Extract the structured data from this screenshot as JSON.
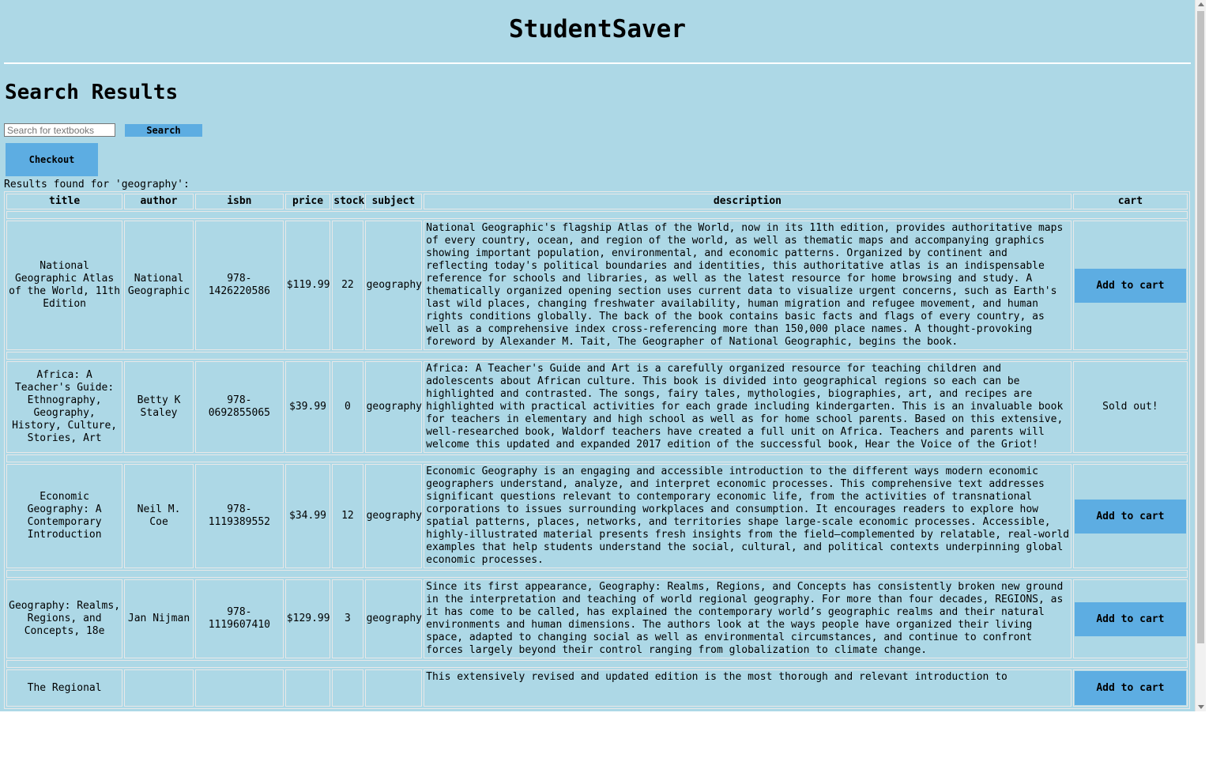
{
  "site": {
    "title": "StudentSaver"
  },
  "page": {
    "heading": "Search Results"
  },
  "search": {
    "placeholder": "Search for textbooks",
    "button_label": "Search"
  },
  "checkout": {
    "label": "Checkout"
  },
  "results": {
    "summary": "Results found for 'geography':"
  },
  "table": {
    "headers": [
      "title",
      "author",
      "isbn",
      "price",
      "stock",
      "subject",
      "description",
      "cart"
    ],
    "rows": [
      {
        "title": "National Geographic Atlas of the World, 11th Edition",
        "author": "National Geographic",
        "isbn": "978-1426220586",
        "price": "$119.99",
        "stock": "22",
        "subject": "geography",
        "description": "National Geographic's flagship Atlas of the World, now in its 11th edition, provides authoritative maps of every country, ocean, and region of the world, as well as thematic maps and accompanying graphics showing important population, environmental, and economic patterns. Organized by continent and reflecting today's political boundaries and identities, this authoritative atlas is an indispensable reference for schools and libraries, as well as the latest resource for home browsing and study. A thematically organized opening section uses current data to visualize urgent concerns, such as Earth's last wild places, changing freshwater availability, human migration and refugee movement, and human rights conditions globally. The back of the book contains basic facts and flags of every country, as well as a comprehensive index cross-referencing more than 150,000 place names. A thought-provoking foreword by Alexander M. Tait, The Geographer of National Geographic, begins the book.",
        "cart": "Add to cart"
      },
      {
        "title": "Africa: A Teacher's Guide: Ethnography, Geography, History, Culture, Stories, Art",
        "author": "Betty K Staley",
        "isbn": "978-0692855065",
        "price": "$39.99",
        "stock": "0",
        "subject": "geography",
        "description": "Africa: A Teacher's Guide and Art is a carefully organized resource for teaching children and adolescents about African culture. This book is divided into geographical regions so each can be highlighted and contrasted. The songs, fairy tales, mythologies, biographies, art, and recipes are highlighted with practical activities for each grade including kindergarten. This is an invaluable book for teachers in elementary and high school as well as for home school parents. Based on this extensive, well-researched book, Waldorf teachers have created a full unit on Africa. Teachers and parents will welcome this updated and expanded 2017 edition of the successful book, Hear the Voice of the Griot!",
        "cart": "Sold out!"
      },
      {
        "title": "Economic Geography: A Contemporary Introduction",
        "author": "Neil M. Coe",
        "isbn": "978-1119389552",
        "price": "$34.99",
        "stock": "12",
        "subject": "geography",
        "description": "Economic Geography is an engaging and accessible introduction to the different ways modern economic geographers understand, analyze, and interpret economic processes. This comprehensive text addresses significant questions relevant to contemporary economic life, from the activities of transnational corporations to issues surrounding workplaces and consumption. It encourages readers to explore how spatial patterns, places, networks, and territories shape large-scale economic processes. Accessible, highly-illustrated material presents fresh insights from the field—complemented by relatable, real-world examples that help students understand the social, cultural, and political contexts underpinning global economic processes.",
        "cart": "Add to cart"
      },
      {
        "title": "Geography: Realms, Regions, and Concepts, 18e",
        "author": "Jan Nijman",
        "isbn": "978-1119607410",
        "price": "$129.99",
        "stock": "3",
        "subject": "geography",
        "description": "Since its first appearance, Geography: Realms, Regions, and Concepts has consistently broken new ground in the interpretation and teaching of world regional geography. For more than four decades, REGIONS, as it has come to be called, has explained the contemporary world’s geographic realms and their natural environments and human dimensions. The authors look at the ways people have organized their living space, adapted to changing social as well as environmental circumstances, and continue to confront forces largely beyond their control ranging from globalization to climate change.",
        "cart": "Add to cart"
      },
      {
        "title": "The Regional",
        "author": "",
        "isbn": "",
        "price": "",
        "stock": "",
        "subject": "",
        "description": "This extensively revised and updated edition is the most thorough and relevant introduction to",
        "cart": "Add to cart"
      }
    ]
  }
}
